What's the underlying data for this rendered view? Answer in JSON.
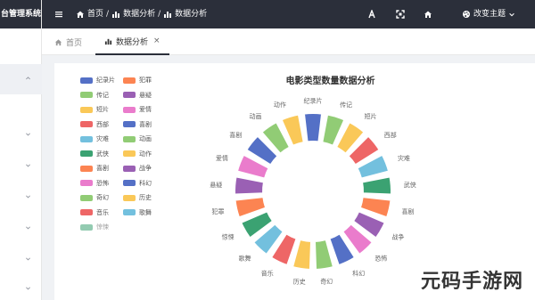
{
  "sidebar": {
    "brand": "台管理系统"
  },
  "navbar": {
    "breadcrumb": [
      "首页",
      "数据分析",
      "数据分析"
    ],
    "theme_label": "改变主题"
  },
  "tabs": [
    {
      "label": "首页"
    },
    {
      "label": "数据分析"
    }
  ],
  "chart_data": {
    "type": "pie",
    "title": "电影类型数量数据分析",
    "categories": [
      "纪录片",
      "传记",
      "短片",
      "西部",
      "灾难",
      "武侠",
      "喜剧",
      "战争",
      "恐怖",
      "科幻",
      "奇幻",
      "历史",
      "音乐",
      "歌舞",
      "惊悚",
      "犯罪",
      "悬疑",
      "爱情",
      "喜剧",
      "动画",
      "动作"
    ],
    "values": [
      1,
      1,
      1,
      1,
      1,
      1,
      1,
      1,
      1,
      1,
      1,
      1,
      1,
      1,
      1,
      1,
      1,
      1,
      1,
      1,
      1
    ],
    "colors": [
      "#5470c6",
      "#91cc75",
      "#fac858",
      "#ee6666",
      "#73c0de",
      "#3ba272",
      "#fc8452",
      "#9a60b4",
      "#ea7ccc",
      "#5470c6",
      "#91cc75",
      "#fac858",
      "#ee6666",
      "#73c0de",
      "#3ba272",
      "#fc8452",
      "#9a60b4",
      "#ea7ccc",
      "#5470c6",
      "#91cc75",
      "#fac858"
    ]
  },
  "legend": [
    {
      "label": "纪录片",
      "color": "#5470c6"
    },
    {
      "label": "犯罪",
      "color": "#fc8452"
    },
    {
      "label": "传记",
      "color": "#91cc75"
    },
    {
      "label": "悬疑",
      "color": "#9a60b4"
    },
    {
      "label": "短片",
      "color": "#fac858"
    },
    {
      "label": "爱情",
      "color": "#ea7ccc"
    },
    {
      "label": "西部",
      "color": "#ee6666"
    },
    {
      "label": "喜剧",
      "color": "#5470c6"
    },
    {
      "label": "灾难",
      "color": "#73c0de"
    },
    {
      "label": "动画",
      "color": "#91cc75"
    },
    {
      "label": "武侠",
      "color": "#3ba272"
    },
    {
      "label": "动作",
      "color": "#fac858"
    },
    {
      "label": "喜剧",
      "color": "#fc8452"
    },
    {
      "label": "战争",
      "color": "#9a60b4"
    },
    {
      "label": "恐怖",
      "color": "#ea7ccc"
    },
    {
      "label": "科幻",
      "color": "#5470c6"
    },
    {
      "label": "奇幻",
      "color": "#91cc75"
    },
    {
      "label": "历史",
      "color": "#fac858"
    },
    {
      "label": "音乐",
      "color": "#ee6666"
    },
    {
      "label": "歌舞",
      "color": "#73c0de"
    },
    {
      "label": "惊悚",
      "color": "#3ba272"
    }
  ],
  "watermark": "元码手游网"
}
